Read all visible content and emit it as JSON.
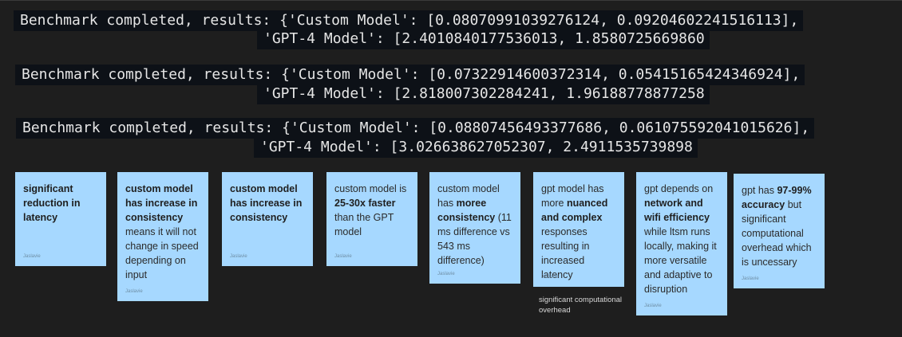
{
  "benchmarks": [
    {
      "line1": "Benchmark completed, results: {'Custom Model': [0.08070991039276124, 0.09204602241516113],",
      "line2": "'GPT-4 Model': [2.4010840177536013, 1.8580725669860"
    },
    {
      "line1": "Benchmark completed, results: {'Custom Model': [0.07322914600372314, 0.05415165424346924],",
      "line2": "'GPT-4 Model': [2.818007302284241, 1.96188778877258"
    },
    {
      "line1": "Benchmark completed, results: {'Custom Model': [0.08807456493377686, 0.061075592041015626],",
      "line2": "'GPT-4 Model': [3.026638627052307, 2.4911535739898"
    }
  ],
  "notes": [
    {
      "parts": [
        {
          "text": "significant reduction in latency",
          "bold": true
        }
      ],
      "author": "Jaslavie"
    },
    {
      "parts": [
        {
          "text": "custom model has increase in consistency",
          "bold": true
        },
        {
          "text": " means it will not change in speed depending on input",
          "bold": false
        }
      ],
      "author": "Jaslavie"
    },
    {
      "parts": [
        {
          "text": "custom model has increase in consistency",
          "bold": true
        }
      ],
      "author": "Jaslavie"
    },
    {
      "parts": [
        {
          "text": "custom model is ",
          "bold": false
        },
        {
          "text": "25-30x faster",
          "bold": true
        },
        {
          "text": " than the GPT model",
          "bold": false
        }
      ],
      "author": "Jaslavie"
    },
    {
      "parts": [
        {
          "text": "custom model has ",
          "bold": false
        },
        {
          "text": "moree consistency",
          "bold": true
        },
        {
          "text": " (11 ms difference vs 543 ms difference)",
          "bold": false
        }
      ],
      "author": "Jaslavie"
    },
    {
      "parts": [
        {
          "text": "gpt model has more ",
          "bold": false
        },
        {
          "text": "nuanced and complex",
          "bold": true
        },
        {
          "text": " responses resulting in increased latency",
          "bold": false
        }
      ],
      "author": "Jaslavie"
    },
    {
      "parts": [
        {
          "text": "gpt depends on ",
          "bold": false
        },
        {
          "text": "network and wifi efficiency",
          "bold": true
        },
        {
          "text": " while ltsm runs locally, making it more versatile and adaptive to disruption",
          "bold": false
        }
      ],
      "author": "Jaslavie"
    },
    {
      "parts": [
        {
          "text": "gpt has ",
          "bold": false
        },
        {
          "text": "97-99% accuracy",
          "bold": true
        },
        {
          "text": " but significant computational overhead which is uncessary",
          "bold": false
        }
      ],
      "author": "Jaslavie"
    }
  ],
  "caption": "significant computational overhead"
}
